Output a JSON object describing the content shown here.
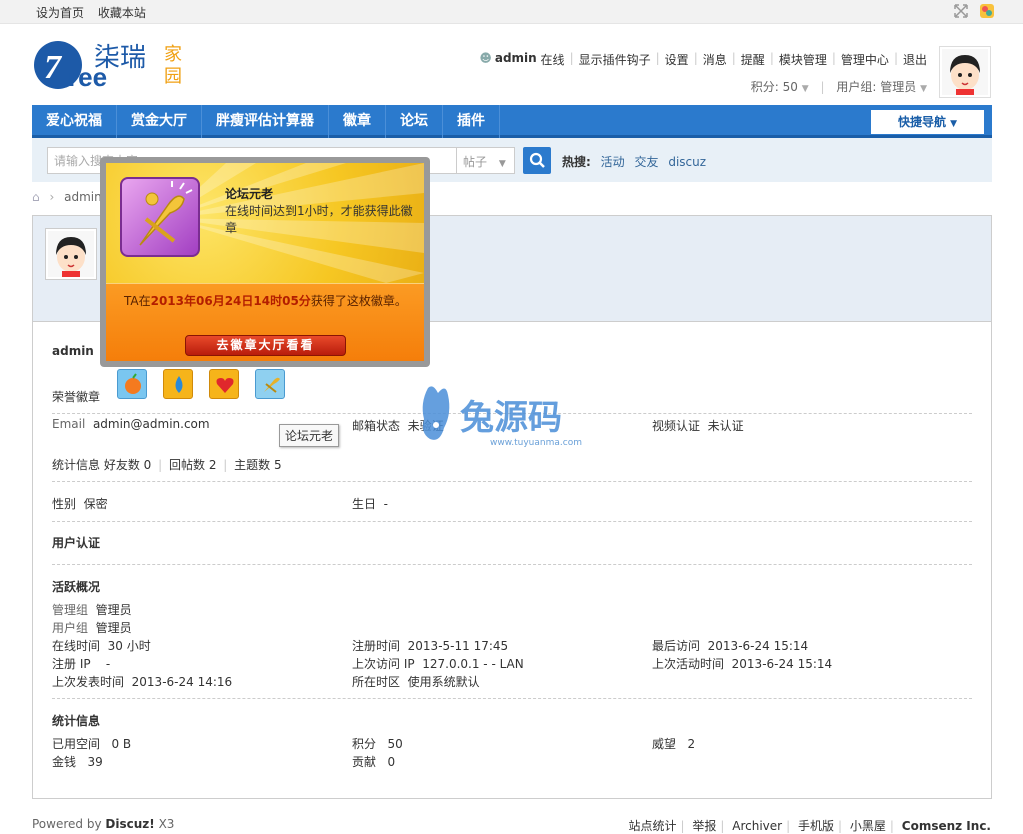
{
  "topbar": {
    "set_home": "设为首页",
    "bookmark": "收藏本站"
  },
  "logo": {
    "text": "7ree",
    "cn1": "柒瑞",
    "cn2": "家园"
  },
  "user": {
    "name": "admin",
    "status": "在线",
    "links": [
      "显示插件钩子",
      "设置",
      "消息",
      "提醒",
      "模块管理",
      "管理中心",
      "退出"
    ],
    "points": "积分: 50",
    "group": "用户组: 管理员"
  },
  "nav": {
    "items": [
      "爱心祝福",
      "赏金大厅",
      "胖瘦评估计算器",
      "徽章",
      "论坛",
      "插件"
    ],
    "quick": "快捷导航"
  },
  "search": {
    "placeholder": "请输入搜索内容",
    "type": "帖子",
    "hot_label": "热搜:",
    "hot": [
      "活动",
      "交友",
      "discuz"
    ]
  },
  "breadcrumb": {
    "user": "admin"
  },
  "popup": {
    "title": "论坛元老",
    "desc": "在线时间达到1小时，才能获得此徽章",
    "msg_prefix": "TA在",
    "msg_date": "2013年06月24日14时05分",
    "msg_suffix": "获得了这枚徽章。",
    "button": "去徽章大厅看看"
  },
  "tooltip": "论坛元老",
  "profile": {
    "username": "admin",
    "badges_label": "荣誉徽章",
    "email_label": "Email",
    "email": "admin@admin.com",
    "mail_status_label": "邮箱状态",
    "mail_status": "未验证",
    "video_label": "视频认证",
    "video": "未认证",
    "stats_label": "统计信息",
    "friends": "好友数 0",
    "replies": "回帖数 2",
    "threads": "主题数 5",
    "gender_label": "性别",
    "gender": "保密",
    "birthday_label": "生日",
    "birthday": "-",
    "cert_title": "用户认证",
    "activity_title": "活跃概况",
    "admin_group_label": "管理组",
    "admin_group": "管理员",
    "user_group_label": "用户组",
    "user_group": "管理员",
    "online_label": "在线时间",
    "online": "30 小时",
    "reg_time_label": "注册时间",
    "reg_time": "2013-5-11 17:45",
    "last_visit_label": "最后访问",
    "last_visit": "2013-6-24 15:14",
    "reg_ip_label": "注册 IP",
    "reg_ip": "-",
    "last_ip_label": "上次访问 IP",
    "last_ip": "127.0.0.1 - - LAN",
    "last_active_label": "上次活动时间",
    "last_active": "2013-6-24 15:14",
    "last_post_label": "上次发表时间",
    "last_post": "2013-6-24 14:16",
    "tz_label": "所在时区",
    "tz": "使用系统默认",
    "stats_title": "统计信息",
    "space_label": "已用空间",
    "space": "0 B",
    "points_label": "积分",
    "points": "50",
    "prestige_label": "威望",
    "prestige": "2",
    "money_label": "金钱",
    "money": "39",
    "contrib_label": "贡献",
    "contrib": "0"
  },
  "watermark": {
    "text": "兔源码",
    "url": "www.tuyuanma.com"
  },
  "footer": {
    "powered": "Powered by",
    "brand": "Discuz!",
    "ver": "X3",
    "links": [
      "站点统计",
      "举报",
      "Archiver",
      "手机版",
      "小黑屋"
    ],
    "company": "Comsenz Inc."
  }
}
